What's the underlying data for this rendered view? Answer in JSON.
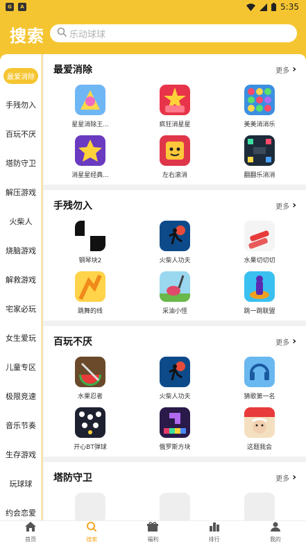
{
  "status": {
    "time": "5:35"
  },
  "header": {
    "title": "搜索",
    "search_placeholder": "乐动球球"
  },
  "sidebar": {
    "items": [
      {
        "label": "最爱消除"
      },
      {
        "label": "手残勿入"
      },
      {
        "label": "百玩不厌"
      },
      {
        "label": "塔防守卫"
      },
      {
        "label": "解压游戏"
      },
      {
        "label": "火柴人"
      },
      {
        "label": "烧脑游戏"
      },
      {
        "label": "解救游戏"
      },
      {
        "label": "宅家必玩"
      },
      {
        "label": "女生爱玩"
      },
      {
        "label": "儿童专区"
      },
      {
        "label": "极限竞速"
      },
      {
        "label": "音乐节奏"
      },
      {
        "label": "生存游戏"
      },
      {
        "label": "玩球球"
      },
      {
        "label": "约会恋爱"
      }
    ]
  },
  "sections": [
    {
      "title": "最爱消除",
      "more": "更多",
      "apps": [
        {
          "name": "星星消除王..."
        },
        {
          "name": "疯狂消星星"
        },
        {
          "name": "美美消消乐"
        },
        {
          "name": "消星星经典..."
        },
        {
          "name": "左右滚消"
        },
        {
          "name": "翻翻乐消消"
        }
      ]
    },
    {
      "title": "手残勿入",
      "more": "更多",
      "apps": [
        {
          "name": "钢琴块2"
        },
        {
          "name": "火柴人功夫"
        },
        {
          "name": "水果切切切"
        },
        {
          "name": "跳舞的线"
        },
        {
          "name": "采油小怪"
        },
        {
          "name": "跳一跳联盟"
        }
      ]
    },
    {
      "title": "百玩不厌",
      "more": "更多",
      "apps": [
        {
          "name": "水果忍者"
        },
        {
          "name": "火柴人功夫"
        },
        {
          "name": "猜歌第一名"
        },
        {
          "name": "开心BT弹球"
        },
        {
          "name": "俄罗斯方块"
        },
        {
          "name": "这题我会"
        }
      ]
    },
    {
      "title": "塔防守卫",
      "more": "更多",
      "apps": []
    }
  ],
  "tabbar": {
    "items": [
      {
        "label": "首页",
        "icon": "home-icon"
      },
      {
        "label": "搜索",
        "icon": "search-icon"
      },
      {
        "label": "福利",
        "icon": "gift-icon"
      },
      {
        "label": "排行",
        "icon": "ranking-icon"
      },
      {
        "label": "我的",
        "icon": "user-icon"
      }
    ]
  },
  "colors": {
    "accent": "#f5c531",
    "active_tab": "#f5a623"
  }
}
